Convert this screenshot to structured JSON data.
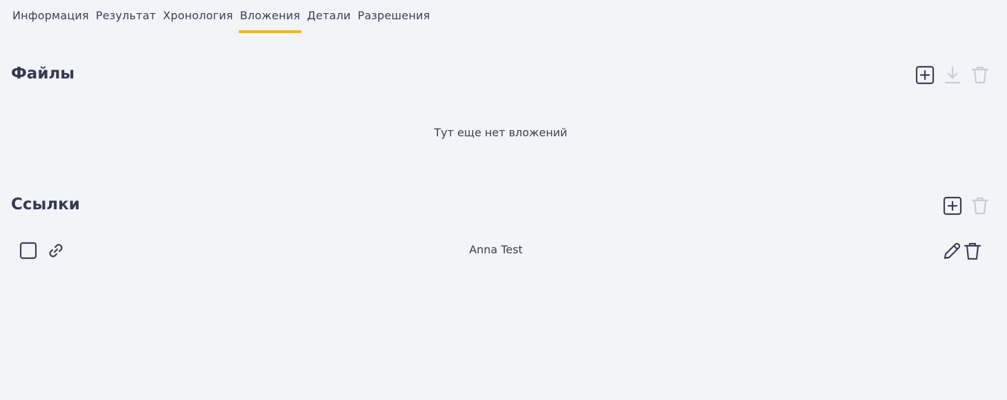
{
  "tabs": [
    {
      "label": "Информация"
    },
    {
      "label": "Результат"
    },
    {
      "label": "Хронология"
    },
    {
      "label": "Вложения"
    },
    {
      "label": "Детали"
    },
    {
      "label": "Разрешения"
    }
  ],
  "active_tab": "Вложения",
  "files": {
    "title": "Файлы",
    "empty_text": "Тут еще нет вложений",
    "actions": {
      "add_icon": "plus-square-icon",
      "download_icon": "download-icon",
      "delete_icon": "trash-icon"
    }
  },
  "links": {
    "title": "Ссылки",
    "actions": {
      "add_icon": "plus-square-icon",
      "delete_icon": "trash-icon"
    },
    "items": [
      {
        "name": "Anna Test",
        "icon": "link-icon"
      }
    ]
  },
  "colors": {
    "background": "#f2f4f8",
    "text": "#343a4e",
    "accent": "#f2b51c",
    "icon_active": "#3a4055",
    "icon_disabled": "#c8ccd6"
  }
}
